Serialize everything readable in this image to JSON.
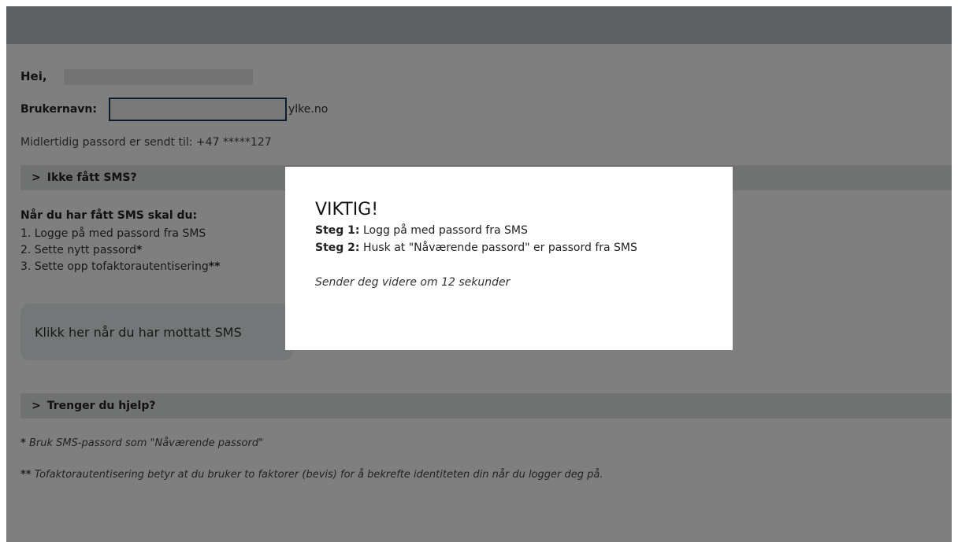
{
  "greeting": "Hei,",
  "username_label": "Brukernavn:",
  "username_suffix": "ylke.no",
  "sent_info": "Midlertidig passord er sendt til: +47 *****127",
  "sms_section": {
    "label": "Ikke fått SMS?"
  },
  "steps": {
    "title": "Når du har fått SMS skal du:",
    "items": [
      "1. Logge på med passord fra SMS",
      "2. Sette nytt passord",
      "3. Sette opp tofaktorautentisering"
    ],
    "item_marks": [
      "",
      "*",
      "**"
    ]
  },
  "click_button": "Klikk her når du har mottatt SMS",
  "help_section": {
    "label": "Trenger du hjelp?"
  },
  "footnotes": {
    "note1_mark": "*",
    "note1": " Bruk SMS-passord som \"Nåværende passord\"",
    "note2_mark": "**",
    "note2": " Tofaktorautentisering betyr at du bruker to faktorer (bevis) for å bekrefte identiteten din når du logger deg på."
  },
  "modal": {
    "title": "VIKTIG!",
    "step1_label": "Steg 1:",
    "step1_text": " Logg på med passord fra SMS",
    "step2_label": "Steg 2:",
    "step2_text": " Husk at \"Nåværende passord\" er passord fra SMS",
    "redirect": "Sender deg videre om 12 sekunder"
  }
}
